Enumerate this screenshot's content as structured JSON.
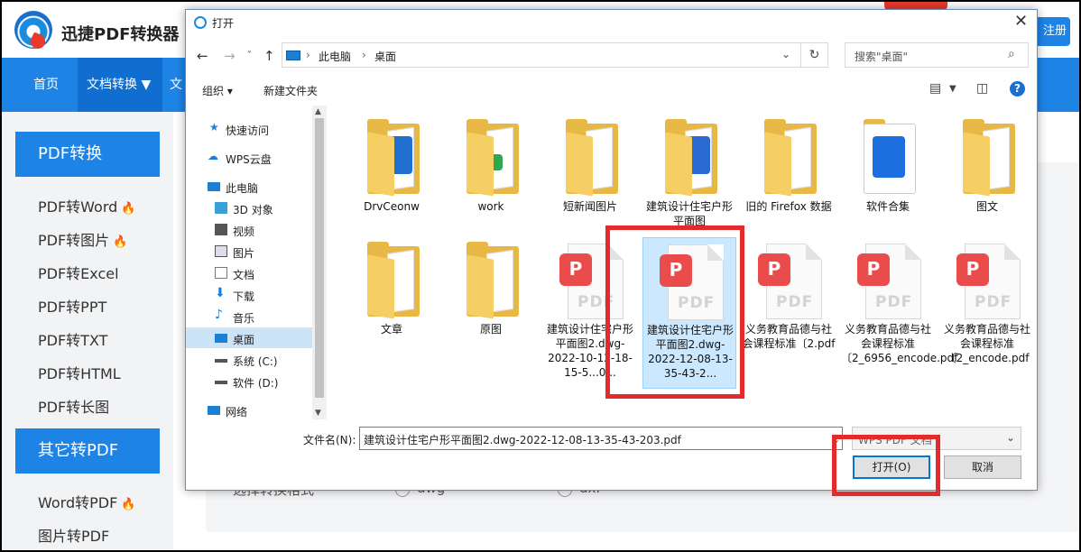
{
  "app": {
    "title": "迅捷PDF转换器",
    "register": "注册",
    "nav": [
      "首页",
      "文档转换 ▼",
      "文"
    ]
  },
  "sidebar": {
    "groups": [
      {
        "title": "PDF转换",
        "items": [
          "PDF转Word",
          "PDF转图片",
          "PDF转Excel",
          "PDF转PPT",
          "PDF转TXT",
          "PDF转HTML",
          "PDF转长图"
        ],
        "hot": [
          true,
          true,
          false,
          false,
          false,
          false,
          false
        ]
      },
      {
        "title": "其它转PDF",
        "items": [
          "Word转PDF",
          "图片转PDF"
        ],
        "hot": [
          true,
          false
        ]
      }
    ]
  },
  "background": {
    "format_label": "选择转换格式",
    "options": [
      "dwg",
      "dxf"
    ]
  },
  "dialog": {
    "title": "打开",
    "close": "✕",
    "path": [
      "此电脑",
      "桌面"
    ],
    "search_placeholder": "搜索\"桌面\"",
    "toolbar": {
      "organize": "组织 ▾",
      "new_folder": "新建文件夹"
    },
    "tree": [
      {
        "label": "快速访问",
        "icon": "star-icon"
      },
      {
        "label": "WPS云盘",
        "icon": "cloud-icon"
      },
      {
        "label": "此电脑",
        "icon": "computer-icon"
      },
      {
        "label": "3D 对象",
        "icon": "cube-icon"
      },
      {
        "label": "视频",
        "icon": "video-icon"
      },
      {
        "label": "图片",
        "icon": "picture-icon"
      },
      {
        "label": "文档",
        "icon": "document-icon"
      },
      {
        "label": "下载",
        "icon": "download-icon"
      },
      {
        "label": "音乐",
        "icon": "music-icon"
      },
      {
        "label": "桌面",
        "icon": "desktop-icon",
        "selected": true
      },
      {
        "label": "系统 (C:)",
        "icon": "drive-icon"
      },
      {
        "label": "软件 (D:)",
        "icon": "drive-icon"
      },
      {
        "label": "网络",
        "icon": "network-icon"
      }
    ],
    "files": [
      {
        "name": "DrvCeonw",
        "kind": "folder"
      },
      {
        "name": "work",
        "kind": "folder"
      },
      {
        "name": "短新闻图片",
        "kind": "folder"
      },
      {
        "name": "建筑设计住宅户形平面图",
        "kind": "folder"
      },
      {
        "name": "旧的 Firefox 数据",
        "kind": "folder"
      },
      {
        "name": "软件合集",
        "kind": "folder"
      },
      {
        "name": "图文",
        "kind": "folder"
      },
      {
        "name": "文章",
        "kind": "folder"
      },
      {
        "name": "原图",
        "kind": "folder"
      },
      {
        "name": "建筑设计住宅户形平面图2.dwg-2022-10-12-18-15-5...0...",
        "kind": "pdf"
      },
      {
        "name": "建筑设计住宅户形平面图2.dwg-2022-12-08-13-35-43-2...",
        "kind": "pdf",
        "selected": true
      },
      {
        "name": "义务教育品德与社会课程标准〔2.pdf",
        "kind": "pdf"
      },
      {
        "name": "义务教育品德与社会课程标准〔2_6956_encode.pdf",
        "kind": "pdf"
      },
      {
        "name": "义务教育品德与社会课程标准〔2_encode.pdf",
        "kind": "pdf"
      }
    ],
    "filename_label": "文件名(N):",
    "filename_value": "建筑设计住宅户形平面图2.dwg-2022-12-08-13-35-43-203.pdf",
    "file_type": "WPS PDF 文档",
    "open_button": "打开(O)",
    "cancel_button": "取消"
  },
  "colors": {
    "accent": "#1d84e6",
    "highlight": "#e42a2a",
    "folder": "#e8b846",
    "pdf_badge": "#ea4c4b"
  }
}
